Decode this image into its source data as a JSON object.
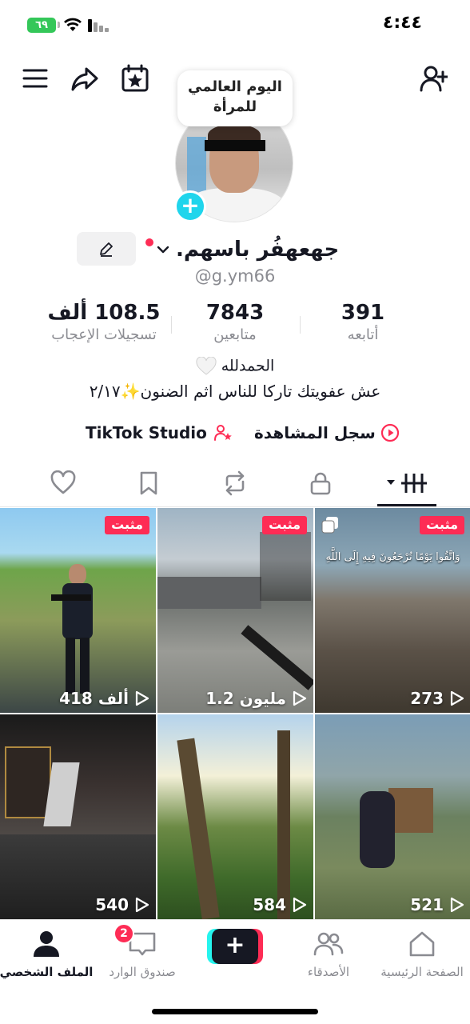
{
  "status_bar": {
    "battery": "٦٩",
    "time": "٤:٤٤"
  },
  "profile": {
    "note": "اليوم العالمي للمرأة",
    "display_name": "جهعهفُر باسهم.",
    "username": "@g.ym66",
    "stats": [
      {
        "value": "391",
        "label": "أتابعه"
      },
      {
        "value": "7843",
        "label": "متابعين"
      },
      {
        "value": "108.5 ألف",
        "label": "تسجيلات الإعجاب"
      }
    ],
    "bio_line1": "الحمدلله",
    "bio_line2": "عش عفويتك تاركا للناس اثم الضنون✨٢/١٧",
    "quick_links": {
      "watch_history": "سجل المشاهدة",
      "studio": "TikTok Studio"
    }
  },
  "tabs": [
    "videos-grid",
    "private",
    "reposts",
    "favorites",
    "liked"
  ],
  "videos": [
    {
      "pinned": "مثبت",
      "views": "418 ألف"
    },
    {
      "pinned": "مثبت",
      "views": "1.2 مليون"
    },
    {
      "pinned": "مثبت",
      "views": "273",
      "caption": "وَاتَّقُوا يَوْمًا تُرْجَعُونَ فِيهِ إِلَى اللَّهِ"
    },
    {
      "views": "540"
    },
    {
      "views": "584"
    },
    {
      "views": "521"
    }
  ],
  "bottom_nav": {
    "home": "الصفحة الرئيسية",
    "friends": "الأصدقاء",
    "create": "+",
    "inbox": "صندوق الوارد",
    "inbox_badge": "2",
    "profile": "الملف الشخصي"
  },
  "colors": {
    "accent": "#fe2c55",
    "cyan": "#20d5ec",
    "text": "#161823",
    "muted": "#8a8b91"
  }
}
